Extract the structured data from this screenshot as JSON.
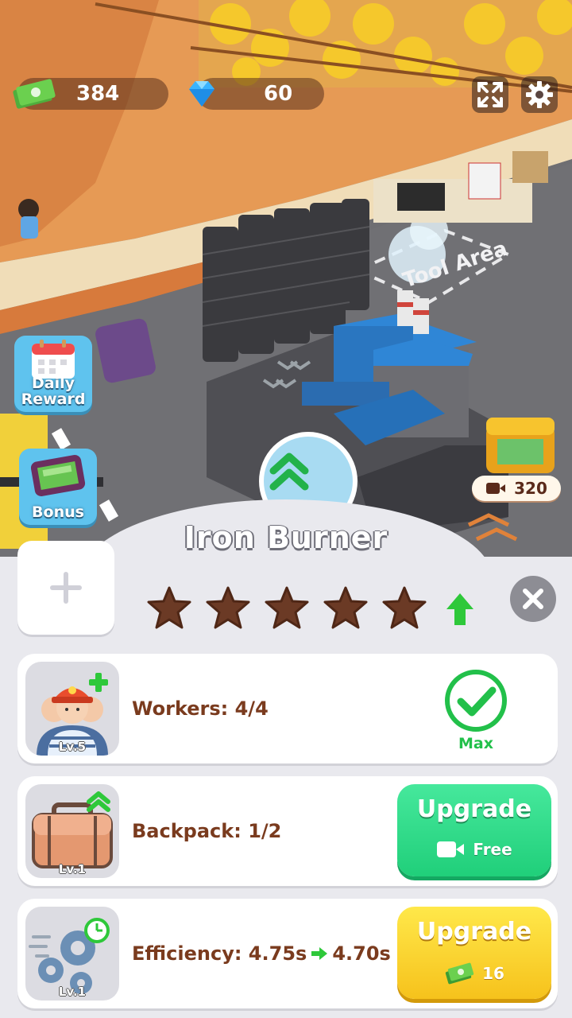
{
  "hud": {
    "cash": "384",
    "gems": "60"
  },
  "side_buttons": {
    "daily_reward": "Daily\nReward",
    "daily_reward_line1": "Daily",
    "daily_reward_line2": "Reward",
    "bonus": "Bonus"
  },
  "scene": {
    "tool_area_label": "Tool Area",
    "chest_reward": "320"
  },
  "panel": {
    "title": "Iron Burner",
    "stars_filled": 0,
    "stars_total": 5,
    "rows": [
      {
        "label": "Workers: 4/4",
        "level": "Lv.5",
        "status": "Max"
      },
      {
        "label": "Backpack: 1/2",
        "level": "Lv.1",
        "button_title": "Upgrade",
        "button_sub": "Free"
      },
      {
        "label_prefix": "Efficiency: 4.75s",
        "label_suffix": "4.70s",
        "level": "Lv.1",
        "button_title": "Upgrade",
        "button_cost": "16"
      }
    ]
  },
  "colors": {
    "label_brown": "#7a3b1e",
    "green_button": "#20cf7a",
    "yellow_button": "#f6c21c",
    "star_empty": "#6b3a25",
    "max_green": "#22c04a"
  }
}
